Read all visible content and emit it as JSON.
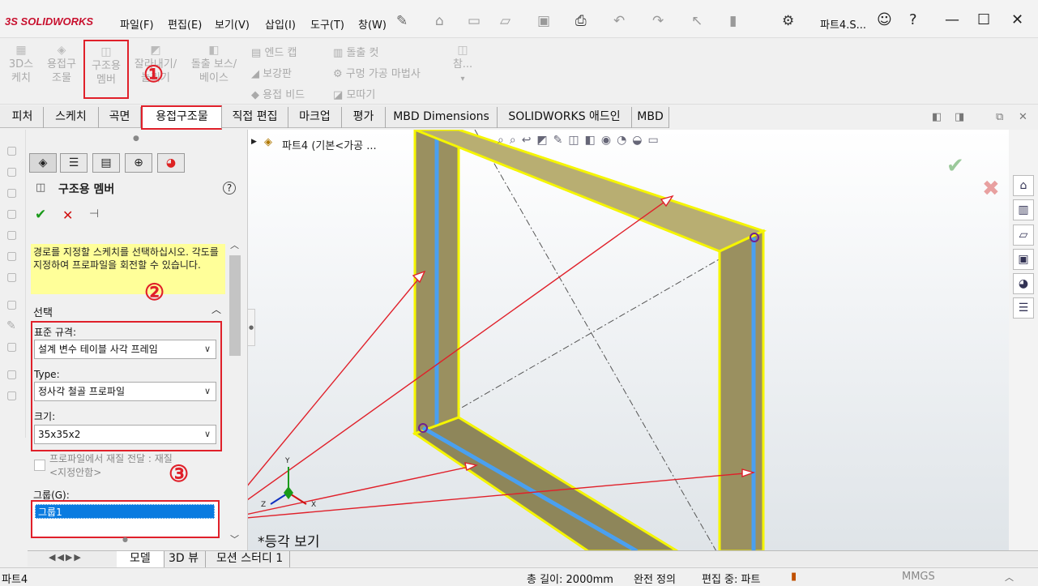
{
  "app": {
    "brand_prefix": "3S",
    "brand": "SOLIDWORKS",
    "window_title": "파트4.S..."
  },
  "menu": [
    "파일(F)",
    "편집(E)",
    "보기(V)",
    "삽입(I)",
    "도구(T)",
    "창(W)"
  ],
  "commands": {
    "sketch3d": [
      "3D스",
      "케치"
    ],
    "weldment": [
      "용접구",
      "조물"
    ],
    "structural_member": [
      "구조용",
      "멤버"
    ],
    "trim": [
      "잘라내기/",
      "늘리기"
    ],
    "extrude_boss": [
      "돌출 보스/",
      "베이스"
    ],
    "end_cap": "엔드 캡",
    "gusset": "보강판",
    "weld_bead": "용접 비드",
    "extrude_cut": "돌출 컷",
    "hole_wizard": "구멍 가공 마법사",
    "chamfer": "모따기",
    "reference": "참..."
  },
  "callouts": {
    "one": "①",
    "two": "②",
    "three": "③"
  },
  "tabs": [
    "피처",
    "스케치",
    "곡면",
    "용접구조물",
    "직접 편집",
    "마크업",
    "평가",
    "MBD Dimensions",
    "SOLIDWORKS 애드인",
    "MBD"
  ],
  "active_tab": "용접구조물",
  "property_manager": {
    "title": "구조용 멤버",
    "help": "?",
    "ok": "✔",
    "cancel": "✕",
    "pin": "⊣",
    "message": "경로를 지정할 스케치를 선택하십시오. 각도를 지정하여 프로파일을 회전할 수 있습니다.",
    "section_title": "선택",
    "standard_label": "표준 규격:",
    "standard_value": "설계 변수 테이블 사각 프레임",
    "type_label": "Type:",
    "type_value": "정사각 철골 프로파일",
    "size_label": "크기:",
    "size_value": "35x35x2",
    "transfer_label": "프로파일에서 재질 전달 : 재질",
    "transfer_sub": "<지정안함>",
    "group_label": "그룹(G):",
    "group_item": "그룹1"
  },
  "tree": {
    "item": "파트4  (기본<가공 ..."
  },
  "viewport": {
    "view_label": "*등각 보기",
    "axis_x": "X",
    "axis_y": "Y",
    "axis_z": "Z"
  },
  "bottom_tabs": [
    "모델",
    "3D 뷰",
    "모션 스터디 1"
  ],
  "status": {
    "part": "파트4",
    "length": "총 길이: 2000mm",
    "defined": "완전 정의",
    "editing": "편집 중: 파트",
    "units": "MMGS"
  },
  "colors": {
    "accent_red": "#e0202a",
    "frame_yellow": "#f5f500",
    "frame_fill": "#9a9060",
    "path_blue": "#4aa0f0",
    "selection_blue": "#0a7be0"
  }
}
